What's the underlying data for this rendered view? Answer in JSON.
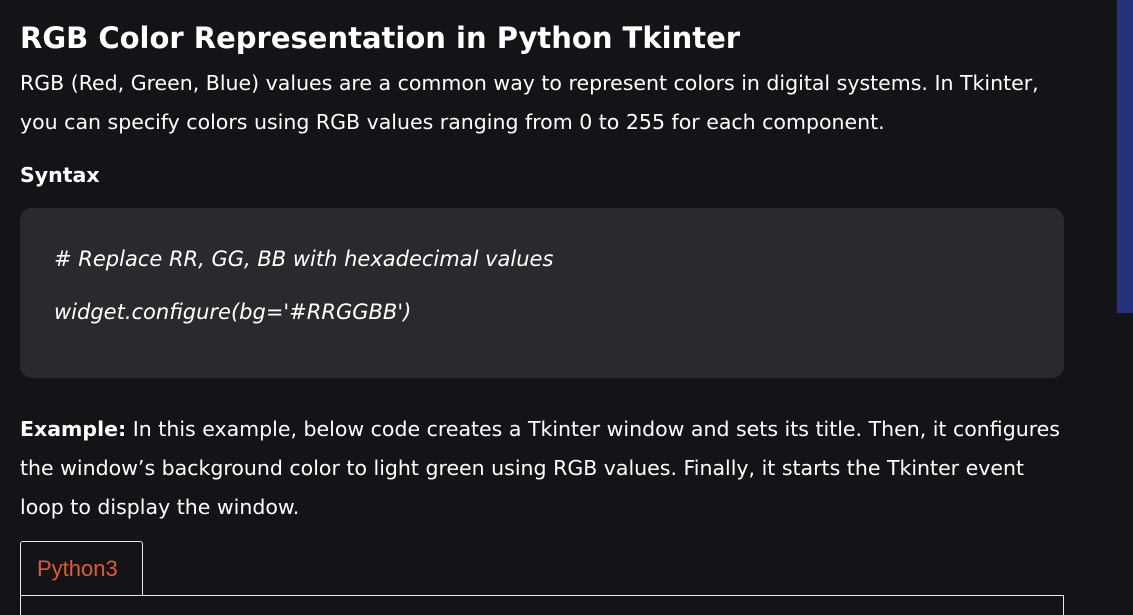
{
  "article": {
    "title": "RGB Color Representation in Python Tkinter",
    "intro": "RGB (Red, Green, Blue) values are a common way to represent colors in digital systems. In Tkinter, you can specify colors using RGB values ranging from 0 to 255 for each component.",
    "syntax_heading": "Syntax",
    "syntax_code": [
      "# Replace RR, GG, BB with hexadecimal values",
      "widget.configure(bg='#RRGGBB')"
    ],
    "example_lead": "Example:",
    "example_text": " In this example, below code creates a Tkinter window and sets its title. Then, it configures the window’s background color to light green using RGB values. Finally, it starts the Tkinter event loop to display the window.",
    "code_tabs": [
      {
        "label": "Python3",
        "active": true
      }
    ]
  },
  "colors": {
    "page_background": "#141418",
    "code_box_background": "#2a2a2e",
    "tab_label": "#e05a33",
    "scrollbar_thumb": "#26337a"
  }
}
